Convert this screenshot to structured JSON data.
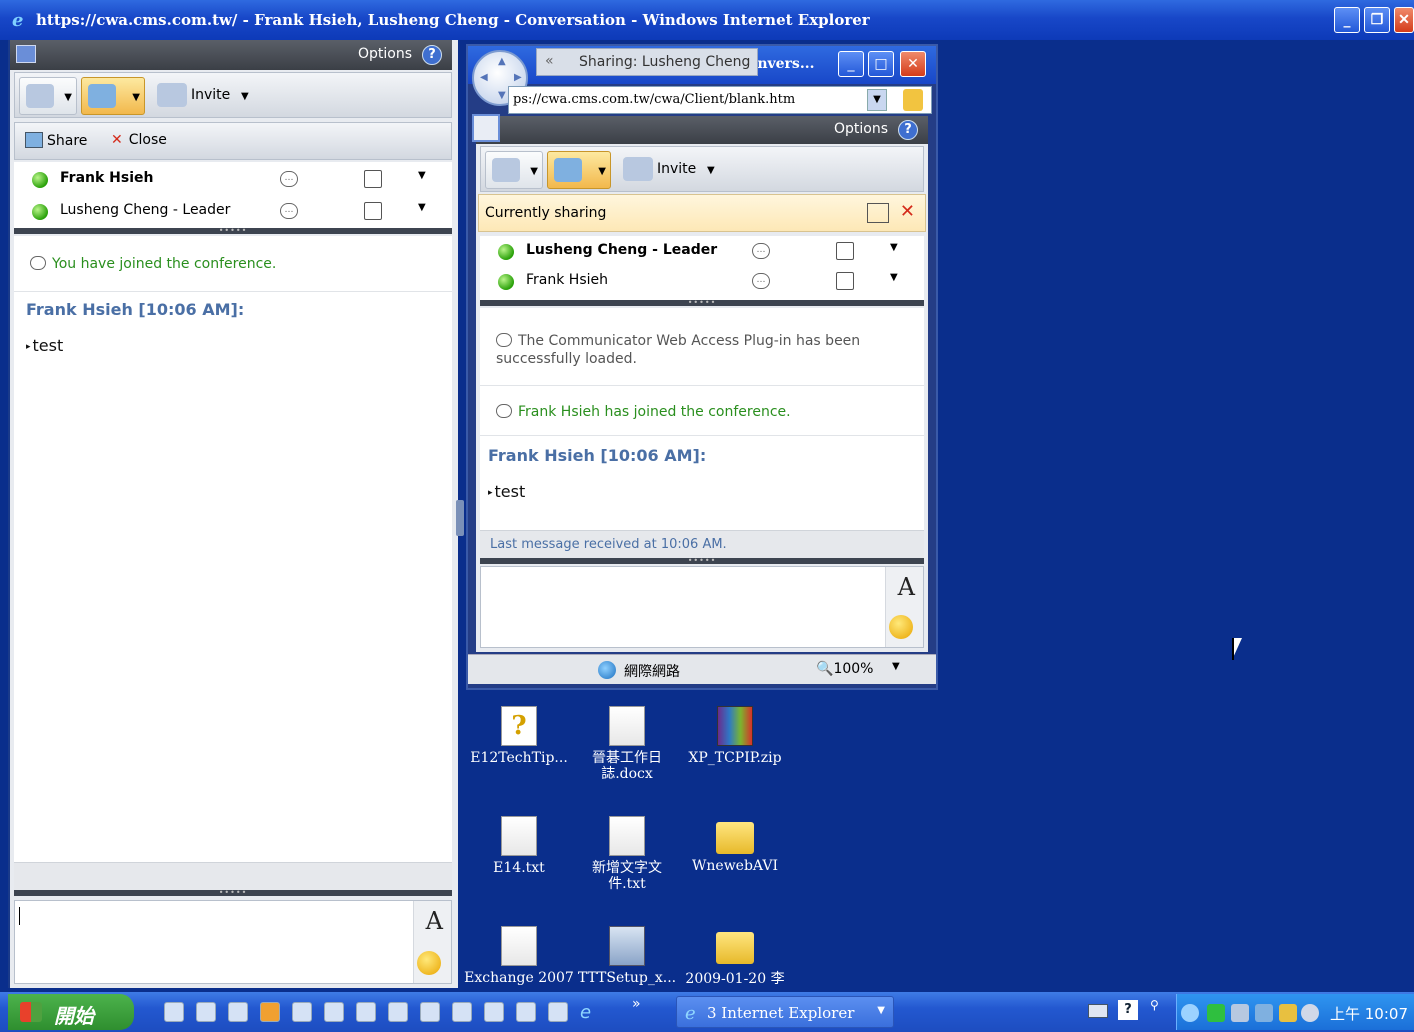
{
  "ie": {
    "title": "https://cwa.cms.com.tw/ - Frank Hsieh, Lusheng Cheng - Conversation - Windows Internet Explorer"
  },
  "left": {
    "options": "Options",
    "invite": "Invite",
    "share": "Share",
    "close": "Close",
    "participants": [
      {
        "name": "Frank Hsieh",
        "bold": true
      },
      {
        "name": "Lusheng Cheng - Leader",
        "bold": false
      }
    ],
    "system_message": "You have joined the conference.",
    "sender": "Frank Hsieh [10:06 AM]:",
    "message": "test"
  },
  "right": {
    "window_title": "onvers...",
    "sharing": "Sharing: Lusheng Cheng",
    "url": "ps://cwa.cms.com.tw/cwa/Client/blank.htm",
    "options": "Options",
    "invite": "Invite",
    "currently_sharing": "Currently sharing",
    "participants": [
      {
        "name": "Lusheng Cheng - Leader",
        "bold": true
      },
      {
        "name": "Frank Hsieh",
        "bold": false
      }
    ],
    "plugin_message": "The Communicator Web Access Plug-in has been successfully loaded.",
    "joined_message": "Frank Hsieh  has joined the conference.",
    "sender": "Frank Hsieh [10:06 AM]:",
    "message": "test",
    "last_received": "Last message received at 10:06 AM.",
    "zone": "網際網路",
    "zoom": "100%"
  },
  "desktop": {
    "icons": [
      {
        "label": "E12TechTip...",
        "type": "help"
      },
      {
        "label": "晉碁工作日誌.docx",
        "type": "doc"
      },
      {
        "label": "XP_TCPIP.zip",
        "type": "zip"
      },
      {
        "label": "E14.txt",
        "type": "doc"
      },
      {
        "label": "新增文字文件.txt",
        "type": "doc"
      },
      {
        "label": "WnewebAVI",
        "type": "folder"
      },
      {
        "label": "Exchange 2007",
        "type": "doc"
      },
      {
        "label": "TTTSetup_x...",
        "type": "exe"
      },
      {
        "label": "2009-01-20 李",
        "type": "folder"
      }
    ]
  },
  "taskbar": {
    "start": "開始",
    "item": "3 Internet Explorer",
    "clock": "上午 10:07"
  }
}
